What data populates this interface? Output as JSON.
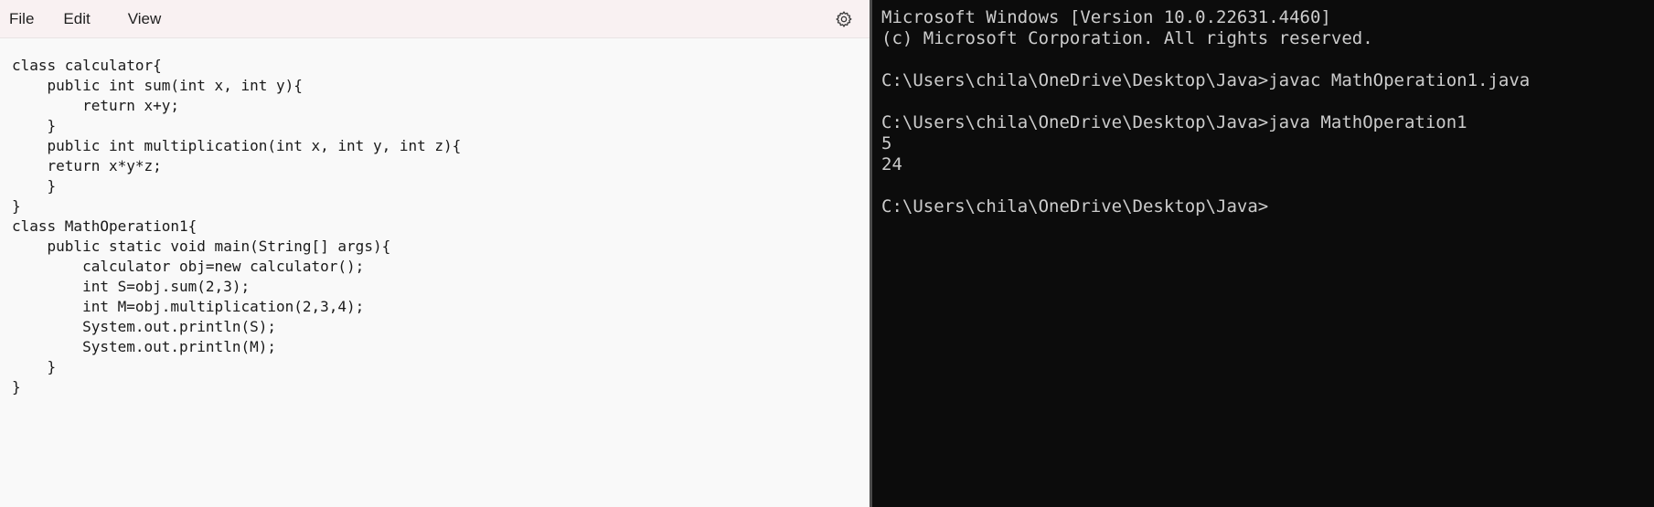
{
  "notepad": {
    "menu": {
      "file": "File",
      "edit": "Edit",
      "view": "View"
    },
    "settings_icon": "gear-icon",
    "code_lines": [
      "class calculator{",
      "    public int sum(int x, int y){",
      "        return x+y;",
      "    }",
      "    public int multiplication(int x, int y, int z){",
      "    return x*y*z;",
      "    }",
      "}",
      "class MathOperation1{",
      "    public static void main(String[] args){",
      "        calculator obj=new calculator();",
      "        int S=obj.sum(2,3);",
      "        int M=obj.multiplication(2,3,4);",
      "        System.out.println(S);",
      "        System.out.println(M);",
      "    }",
      "}"
    ]
  },
  "terminal": {
    "lines": [
      "Microsoft Windows [Version 10.0.22631.4460]",
      "(c) Microsoft Corporation. All rights reserved.",
      "",
      "C:\\Users\\chila\\OneDrive\\Desktop\\Java>javac MathOperation1.java",
      "",
      "C:\\Users\\chila\\OneDrive\\Desktop\\Java>java MathOperation1",
      "5",
      "24",
      "",
      "C:\\Users\\chila\\OneDrive\\Desktop\\Java>"
    ]
  }
}
